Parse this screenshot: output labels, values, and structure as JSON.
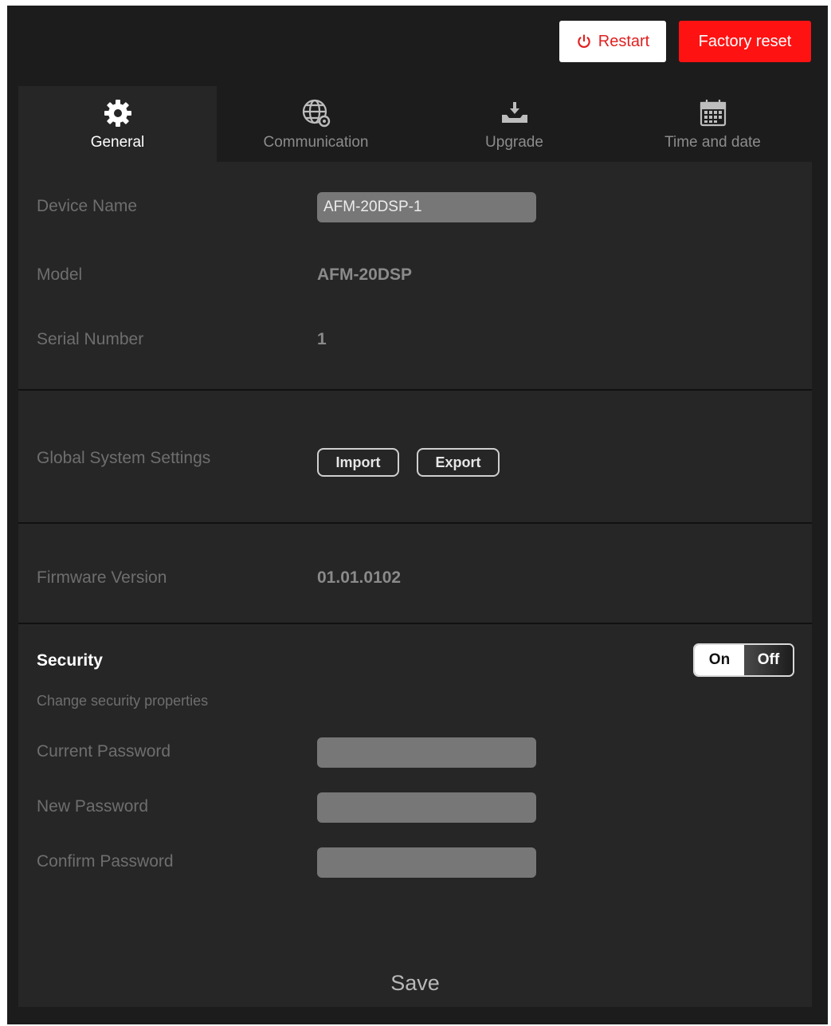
{
  "actions": {
    "restart_label": "Restart",
    "factory_reset_label": "Factory reset"
  },
  "tabs": [
    {
      "label": "General",
      "icon": "gear-icon",
      "active": true
    },
    {
      "label": "Communication",
      "icon": "globe-gear-icon",
      "active": false
    },
    {
      "label": "Upgrade",
      "icon": "upload-tray-icon",
      "active": false
    },
    {
      "label": "Time and date",
      "icon": "calendar-icon",
      "active": false
    }
  ],
  "general": {
    "device_name_label": "Device Name",
    "device_name_value": "AFM-20DSP-1",
    "model_label": "Model",
    "model_value": "AFM-20DSP",
    "serial_label": "Serial Number",
    "serial_value": "1"
  },
  "global_settings": {
    "label": "Global System Settings",
    "import_label": "Import",
    "export_label": "Export"
  },
  "firmware": {
    "label": "Firmware Version",
    "value": "01.01.0102"
  },
  "security": {
    "title": "Security",
    "subtitle": "Change security properties",
    "toggle_on_label": "On",
    "toggle_off_label": "Off",
    "current_password_label": "Current Password",
    "new_password_label": "New Password",
    "confirm_password_label": "Confirm Password"
  },
  "save_label": "Save",
  "colors": {
    "background": "#1c1c1c",
    "panel": "#262626",
    "accent_red": "#ff1212",
    "field": "#777777"
  }
}
